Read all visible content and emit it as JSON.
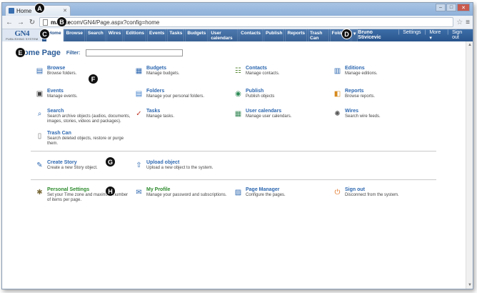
{
  "browser": {
    "tab_title": "Home",
    "url_host": "main.te",
    "url_rest": "com/GN4/Page.aspx?config=home"
  },
  "app": {
    "logo_text": "GN4",
    "logo_sub": "PUBLISHING SYSTEM",
    "nav": [
      "Home",
      "Browse",
      "Search",
      "Wires",
      "Editions",
      "Events",
      "Tasks",
      "Budgets",
      "User calendars",
      "Contacts",
      "Publish",
      "Reports",
      "Trash Can",
      "Folders",
      "▾"
    ],
    "user": "Bruno Stivicevic",
    "settings": "Settings",
    "more": "More ▾",
    "signout": "Sign out"
  },
  "page": {
    "title": "Home Page",
    "filter_label": "Filter:",
    "filter_value": ""
  },
  "callouts": [
    "A",
    "B",
    "C",
    "D",
    "E",
    "F",
    "G",
    "H"
  ],
  "tiles": [
    {
      "title": "Browse",
      "desc": "Browse folders.",
      "icon": "browse-icon"
    },
    {
      "title": "Budgets",
      "desc": "Manage budgets.",
      "icon": "budgets-icon"
    },
    {
      "title": "Contacts",
      "desc": "Manage contacts.",
      "icon": "contacts-icon"
    },
    {
      "title": "Editions",
      "desc": "Manage editions.",
      "icon": "editions-icon"
    },
    {
      "title": "Events",
      "desc": "Manage events.",
      "icon": "events-icon"
    },
    {
      "title": "Folders",
      "desc": "Manage your personal folders.",
      "icon": "folders-icon"
    },
    {
      "title": "Publish",
      "desc": "Publish objects",
      "icon": "publish-icon"
    },
    {
      "title": "Reports",
      "desc": "Browse reports.",
      "icon": "reports-icon"
    },
    {
      "title": "Search",
      "desc": "Search archive objects (audios, documents, images, stories, videos and packages).",
      "icon": "search-icon"
    },
    {
      "title": "Tasks",
      "desc": "Manage tasks.",
      "icon": "tasks-icon"
    },
    {
      "title": "User calendars",
      "desc": "Manage user calendars.",
      "icon": "calendar-icon"
    },
    {
      "title": "Wires",
      "desc": "Search wire feeds.",
      "icon": "wires-icon"
    },
    {
      "title": "Trash Can",
      "desc": "Search deleted objects, restore or purge them.",
      "icon": "trash-icon"
    },
    {
      "title": "Create Story",
      "desc": "Create a new Story object.",
      "icon": "create-story-icon"
    },
    {
      "title": "Upload object",
      "desc": "Upload a new object to the system.",
      "icon": "upload-icon"
    },
    {
      "title": "Personal Settings",
      "desc": "Set your Time zone and maximum number of items per page.",
      "icon": "settings-icon"
    },
    {
      "title": "My Profile",
      "desc": "Manage your password and subscriptions.",
      "icon": "profile-icon"
    },
    {
      "title": "Page Manager",
      "desc": "Configure the pages.",
      "icon": "page-manager-icon"
    },
    {
      "title": "Sign out",
      "desc": "Disconnect from the system.",
      "icon": "signout-icon"
    }
  ]
}
